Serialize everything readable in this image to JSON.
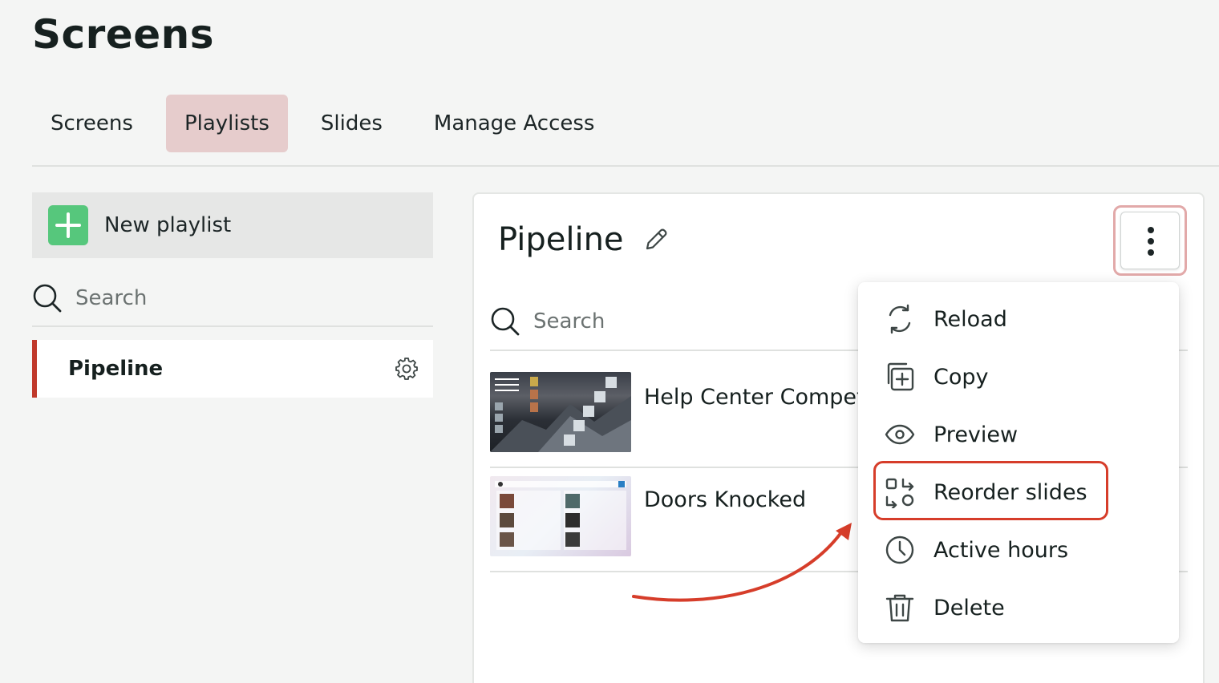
{
  "page": {
    "title": "Screens"
  },
  "tabs": [
    {
      "label": "Screens",
      "active": false
    },
    {
      "label": "Playlists",
      "active": true
    },
    {
      "label": "Slides",
      "active": false
    },
    {
      "label": "Manage Access",
      "active": false
    }
  ],
  "sidebar": {
    "new_playlist_label": "New playlist",
    "search_placeholder": "Search",
    "playlists": [
      {
        "label": "Pipeline",
        "selected": true
      }
    ]
  },
  "panel": {
    "title": "Pipeline",
    "search_placeholder": "Search",
    "slides": [
      {
        "title": "Help Center Compet"
      },
      {
        "title": "Doors Knocked"
      }
    ]
  },
  "menu": {
    "items": [
      {
        "label": "Reload",
        "icon": "reload-icon"
      },
      {
        "label": "Copy",
        "icon": "copy-icon"
      },
      {
        "label": "Preview",
        "icon": "eye-icon"
      },
      {
        "label": "Reorder slides",
        "icon": "reorder-icon",
        "highlighted": true
      },
      {
        "label": "Active hours",
        "icon": "clock-icon"
      },
      {
        "label": "Delete",
        "icon": "trash-icon"
      }
    ]
  },
  "colors": {
    "accent": "#c0392b",
    "active_tab": "#e6cccc",
    "new_button": "#56c77c",
    "annotation": "#d63d2a"
  }
}
